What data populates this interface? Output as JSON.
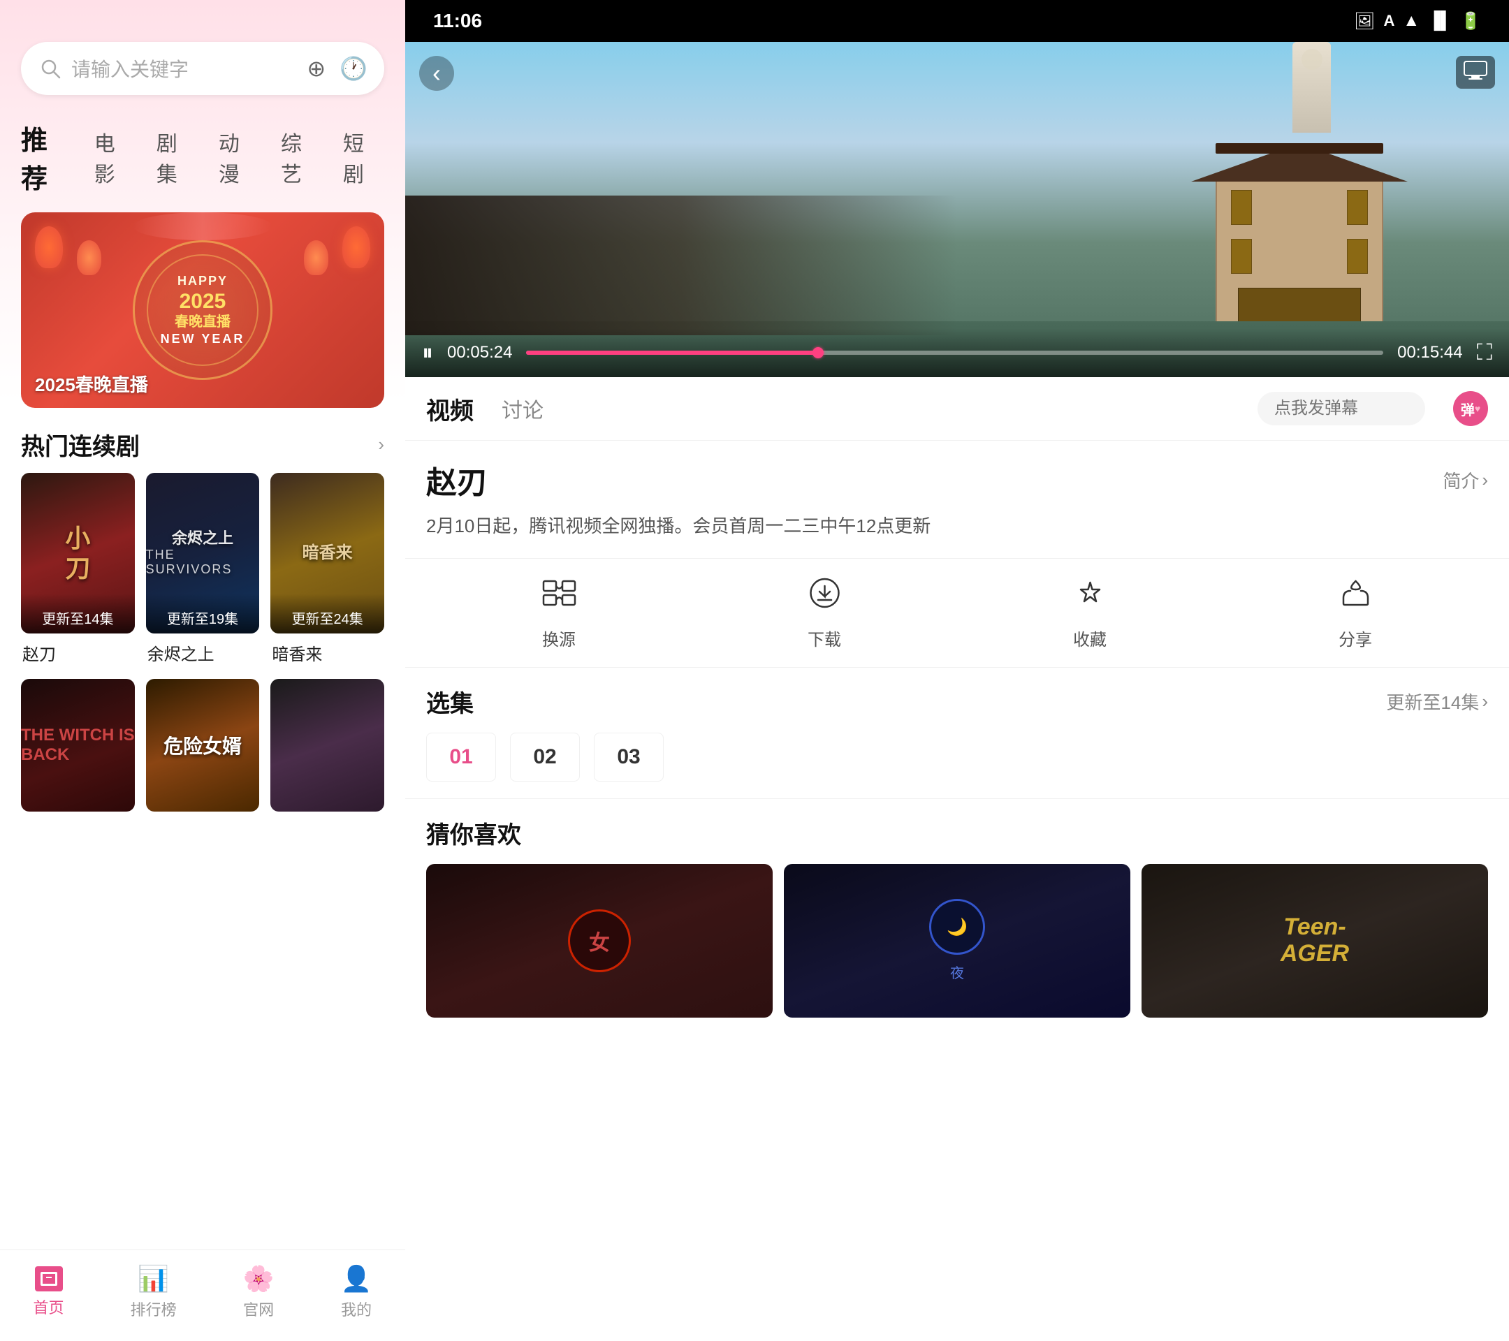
{
  "left": {
    "search": {
      "placeholder": "请输入关键字"
    },
    "nav_tabs": [
      {
        "label": "推荐",
        "active": true
      },
      {
        "label": "电影",
        "active": false
      },
      {
        "label": "剧集",
        "active": false
      },
      {
        "label": "动漫",
        "active": false
      },
      {
        "label": "综艺",
        "active": false
      },
      {
        "label": "短剧",
        "active": false
      }
    ],
    "banner": {
      "happy": "HAPPY",
      "year": "2025春晚直播",
      "new_year": "NEW YEAR",
      "label": "2025春晚直播"
    },
    "hot_dramas": {
      "title": "热门连续剧",
      "more_icon": "›",
      "items": [
        {
          "title": "赵刀",
          "update": "更新至14集",
          "title_cn": "赵刀",
          "title_alt": "小刀"
        },
        {
          "title": "余烬之上",
          "update": "更新至19集",
          "title_cn": "余烬之上",
          "title_en": "THE SURVIVORS"
        },
        {
          "title": "暗香来",
          "update": "更新至24集",
          "title_cn": "暗香来"
        }
      ],
      "items2": [
        {
          "title": "",
          "title_cn": ""
        },
        {
          "title": "",
          "title_cn": "危险女婿"
        },
        {
          "title": "",
          "title_cn": ""
        }
      ]
    },
    "bottom_nav": [
      {
        "label": "首页",
        "active": true,
        "icon": "✉"
      },
      {
        "label": "排行榜",
        "active": false,
        "icon": "📊"
      },
      {
        "label": "官网",
        "active": false,
        "icon": "🌸"
      },
      {
        "label": "我的",
        "active": false,
        "icon": "👤"
      }
    ]
  },
  "right": {
    "status_bar": {
      "time": "11:06",
      "icons": [
        "🖼",
        "A",
        "▲",
        "📶",
        "🔋"
      ]
    },
    "video": {
      "current_time": "00:05:24",
      "total_time": "00:15:44",
      "progress_percent": 34
    },
    "tabs": [
      {
        "label": "视频",
        "active": true
      },
      {
        "label": "讨论",
        "active": false
      }
    ],
    "barrage_placeholder": "点我发弹幕",
    "barrage_label": "弹",
    "show": {
      "title": "赵刃",
      "intro_label": "简介",
      "description": "2月10日起，腾讯视频全网独播。会员首周一二三中午12点更新"
    },
    "actions": [
      {
        "icon": "⇄",
        "label": "换源"
      },
      {
        "icon": "⊕",
        "label": "下载"
      },
      {
        "icon": "☆",
        "label": "收藏"
      },
      {
        "icon": "↻",
        "label": "分享"
      }
    ],
    "episodes": {
      "title": "选集",
      "update_label": "更新至14集",
      "items": [
        {
          "num": "01",
          "active": true
        },
        {
          "num": "02",
          "active": false
        },
        {
          "num": "03",
          "active": false
        }
      ]
    },
    "recommend": {
      "title": "猜你喜欢",
      "items": [
        {
          "bg": "rec-bg1"
        },
        {
          "bg": "rec-bg2"
        },
        {
          "bg": "rec-bg3",
          "text": "Teen-AGER"
        }
      ]
    }
  }
}
